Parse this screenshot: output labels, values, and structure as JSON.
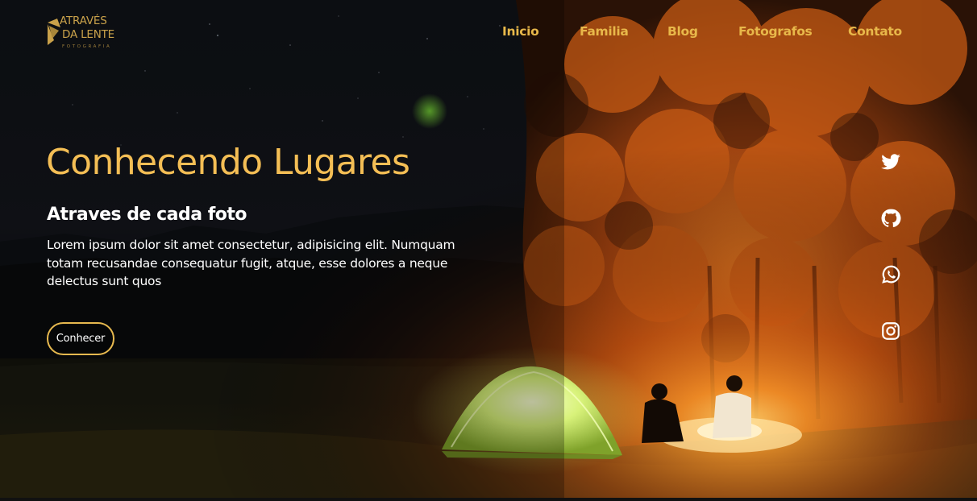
{
  "brand": {
    "line1": "ATRAVÉS",
    "line2": "DA LENTE",
    "sub": "FOTOGRAFIA",
    "color": "#c9a14a"
  },
  "nav": {
    "items": [
      {
        "label": "Inicio"
      },
      {
        "label": "Familia"
      },
      {
        "label": "Blog"
      },
      {
        "label": "Fotografos"
      },
      {
        "label": "Contato"
      }
    ],
    "color": "#e8b84a"
  },
  "hero": {
    "title": "Conhecendo Lugares",
    "subtitle": "Atraves de cada foto",
    "text": "Lorem ipsum dolor sit amet consectetur, adipisicing elit. Numquam totam recusandae consequatur fugit, atque, esse dolores a neque delectus sunt quos",
    "button_label": "Conhecer",
    "accent": "#f4be55"
  },
  "social": [
    {
      "icon": "twitter-icon"
    },
    {
      "icon": "github-icon"
    },
    {
      "icon": "whatsapp-icon"
    },
    {
      "icon": "instagram-icon"
    }
  ],
  "background": {
    "icons": [
      "tent",
      "campfire",
      "trees",
      "people"
    ]
  }
}
